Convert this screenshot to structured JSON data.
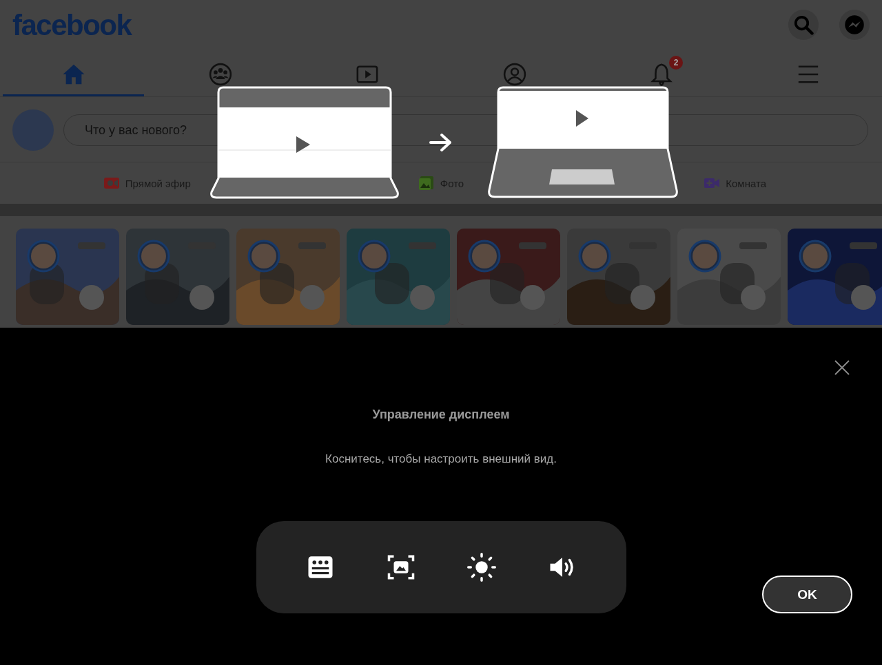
{
  "header": {
    "logo": "facebook",
    "actions": [
      {
        "kind": "search"
      },
      {
        "kind": "messenger"
      }
    ]
  },
  "tabs": [
    {
      "kind": "home",
      "selected": true
    },
    {
      "kind": "groups",
      "selected": false
    },
    {
      "kind": "video",
      "selected": false
    },
    {
      "kind": "profile",
      "selected": false
    },
    {
      "kind": "notifications",
      "selected": false,
      "badge": "2"
    },
    {
      "kind": "menu",
      "selected": false
    }
  ],
  "composer": {
    "placeholder": "Что у вас нового?"
  },
  "post_actions": [
    {
      "kind": "live",
      "label": "Прямой эфир"
    },
    {
      "label": "Фото"
    },
    {
      "kind": "room",
      "label": "Комната"
    }
  ],
  "dialog": {
    "title": "Управление дисплеем",
    "message": "Коснитесь, чтобы настроить внешний вид.",
    "controls": [
      {
        "kind": "layout"
      },
      {
        "kind": "screen"
      },
      {
        "kind": "brightness"
      },
      {
        "kind": "volume"
      }
    ],
    "ok_button": "OK"
  }
}
